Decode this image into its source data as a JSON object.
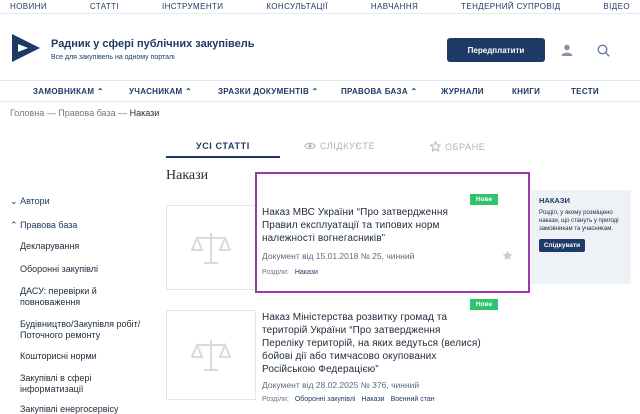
{
  "topbar": {
    "items": [
      "НОВИНИ",
      "СТАТТІ",
      "ІНСТРУМЕНТИ",
      "КОНСУЛЬТАЦІЇ",
      "НАВЧАННЯ",
      "ТЕНДЕРНИЙ СУПРОВІД",
      "ВІДЕО"
    ]
  },
  "header": {
    "title": "Радник у сфері публічних закупівель",
    "subtitle": "Все для закупівель на одному порталі",
    "subscribe_label": "Передплатити",
    "user_icon": "user-icon",
    "search_icon": "search-icon"
  },
  "nav": {
    "items": [
      "ЗАМОВНИКАМ ⌃",
      "УЧАСНИКАМ ⌃",
      "ЗРАЗКИ ДОКУМЕНТІВ ⌃",
      "ПРАВОВА БАЗА ⌃",
      "ЖУРНАЛИ",
      "КНИГИ",
      "ТЕСТИ"
    ]
  },
  "breadcrumb": {
    "home": "Головна",
    "sep": "—",
    "section": "Правова база",
    "current": "Накази"
  },
  "tabs": {
    "all": "УСІ СТАТТІ",
    "following": "СЛІДКУЄТЕ",
    "favorite": "ОБРАНЕ"
  },
  "page_title": "Накази",
  "sidebar": {
    "authors": "Автори",
    "legal_base": "Правова база",
    "items": [
      "Декларування",
      "Оборонні закупівлі",
      "ДАСУ: перевірки й",
      "повноваження",
      "Будівництво/Закупівля робіт/",
      "Поточного ремонту",
      "Кошторисні норми",
      "Закупівлі в сфері",
      "інформатизації",
      "Закупівлі енергосервісу"
    ]
  },
  "articles": [
    {
      "badge": "Нове",
      "title_lines": [
        "Наказ МВС України “Про затвердження",
        "Правил експлуатації та типових норм",
        "належності вогнегасників”"
      ],
      "meta": "Документ від 15.01.2018 № 25, чинний",
      "sections_label": "Розділи:",
      "sections": [
        "Накази"
      ]
    },
    {
      "badge": "Нове",
      "title_lines": [
        "Наказ Міністерства розвитку громад та",
        "територій України “Про затвердження",
        "Переліку територій, на яких ведуться (велися)",
        "бойові дії або тимчасово окупованих",
        "Російською Федерацією”"
      ],
      "meta": "Документ від 28.02.2025 № 376, чинний",
      "sections_label": "Розділи:",
      "sections": [
        "Оборонні закупівлі",
        "Накази",
        "Воєнний стан"
      ]
    }
  ],
  "promo": {
    "title": "НАКАЗИ",
    "text": "Розділ, у якому розміщено накази, що стануть у пригоді замовникам та учасникам.",
    "button": "Слідкувати"
  },
  "colors": {
    "brand": "#1e3a66",
    "badge": "#2ec46c",
    "highlight": "#9b3ba8"
  }
}
